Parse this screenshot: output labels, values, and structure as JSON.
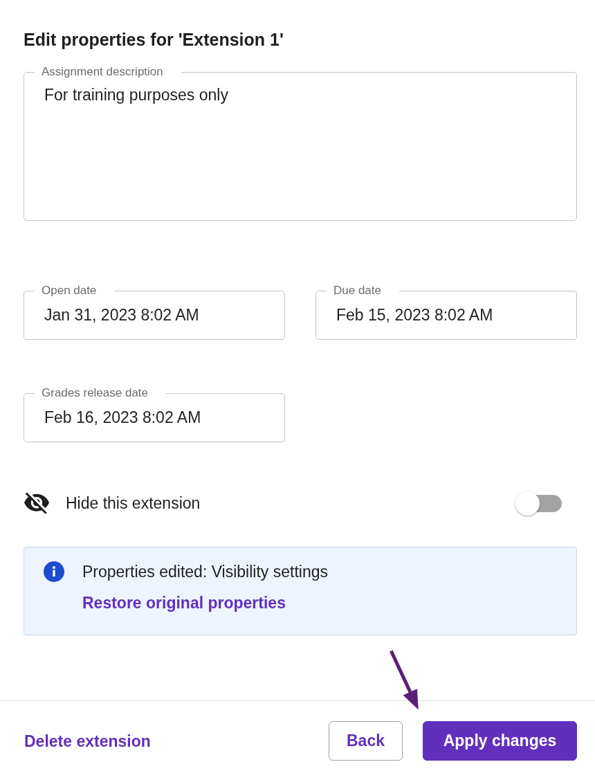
{
  "title": "Edit properties for 'Extension 1'",
  "fields": [
    {
      "kind": "multiline",
      "label": "Assignment description",
      "value": "For training purposes only"
    },
    {
      "kind": "date",
      "label": "Open date",
      "value": "Jan 31, 2023 8:02 AM"
    },
    {
      "kind": "date",
      "label": "Due date",
      "value": "Feb 15, 2023 8:02 AM"
    },
    {
      "kind": "date",
      "label": "Grades release date",
      "value": "Feb 16, 2023 8:02 AM"
    }
  ],
  "hide_toggle": {
    "label": "Hide this extension",
    "on": false
  },
  "notice": {
    "message": "Properties edited: Visibility settings",
    "link": "Restore original properties"
  },
  "footer": {
    "delete_link": "Delete extension",
    "buttons": [
      {
        "kind": "secondary",
        "label": "Back"
      },
      {
        "kind": "primary",
        "label": "Apply changes"
      }
    ]
  },
  "annotations": [
    {
      "kind": "arrow"
    }
  ]
}
